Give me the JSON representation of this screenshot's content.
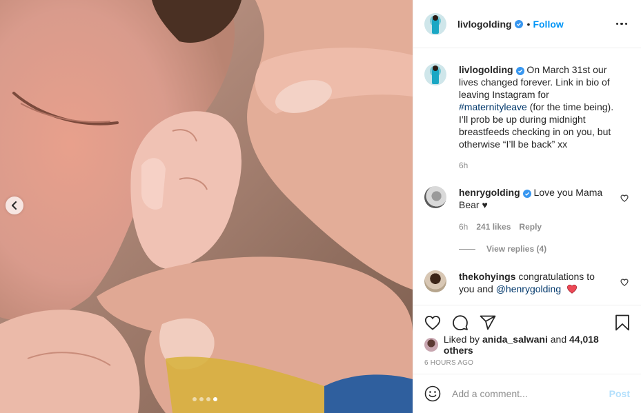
{
  "post": {
    "username": "livlogolding",
    "follow_label": "Follow",
    "separator": "•",
    "carousel": {
      "total": 4,
      "active": 4
    }
  },
  "caption": {
    "username": "livlogolding",
    "text_before": " On March 31st our lives changed forever. Link in bio of leaving Instagram for ",
    "hashtag": "#maternityleave",
    "text_after": " (for the time being). I’ll prob be up during midnight breastfeeds checking in on you, but otherwise “I’ll be back” xx",
    "time": "6h"
  },
  "comments": [
    {
      "username": "henrygolding",
      "verified": true,
      "text": " Love you Mama Bear ♥",
      "time": "6h",
      "likes": "241 likes",
      "reply_label": "Reply",
      "view_replies": "View replies (4)"
    },
    {
      "username": "thekohyings",
      "text": " congratulations to you and ",
      "mention": "@henrygolding",
      "emoji": "heart"
    }
  ],
  "engagement": {
    "liked_by_prefix": "Liked by ",
    "liked_by_user": "anida_salwani",
    "and_label": " and ",
    "others": "44,018 others",
    "time_ago": "6 HOURS AGO"
  },
  "add_comment": {
    "placeholder": "Add a comment...",
    "post_label": "Post"
  },
  "colors": {
    "link_blue": "#0095f6",
    "verified_blue": "#3897f0",
    "post_disabled": "#b2dffc",
    "heart_red": "#ed4956"
  },
  "icons": {
    "prev": "chevron-left-icon",
    "more": "more-horizontal-icon",
    "like": "heart-outline-icon",
    "comment": "comment-bubble-icon",
    "share": "paper-plane-icon",
    "save": "bookmark-icon",
    "emoji": "smiley-icon"
  }
}
